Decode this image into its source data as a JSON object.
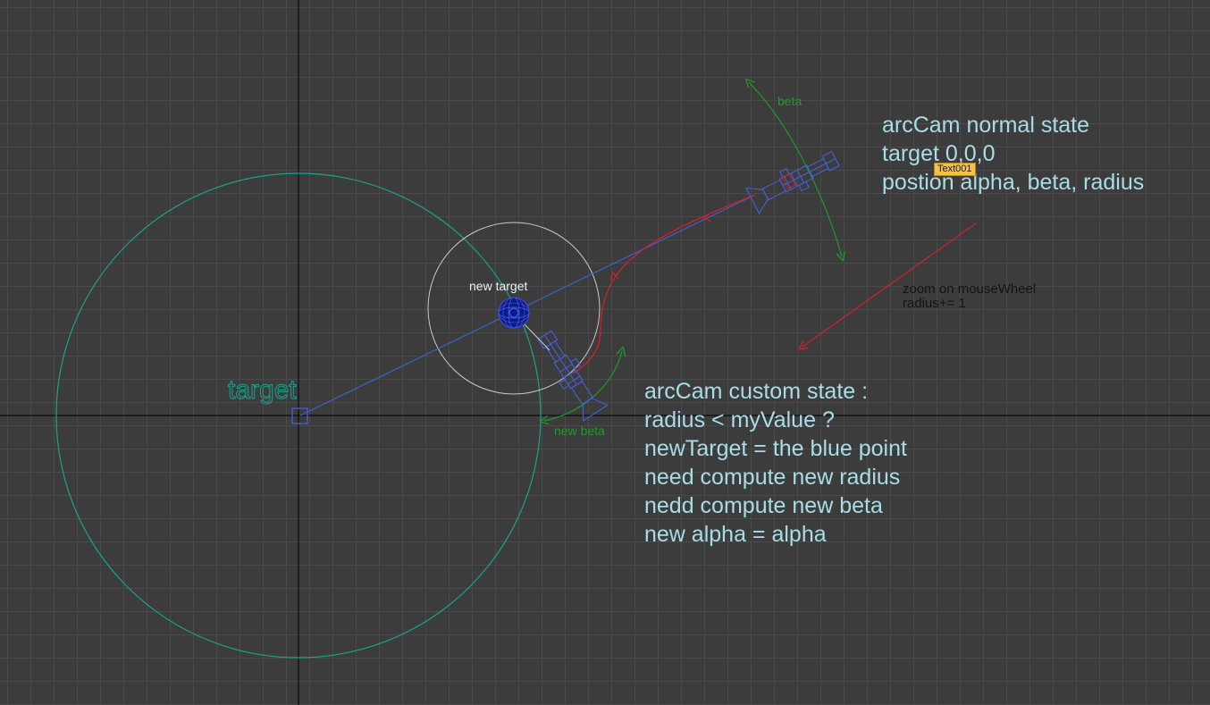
{
  "labels": {
    "target": "target",
    "new_target": "new target",
    "beta": "beta",
    "new_beta": "new beta",
    "object_tag": "Text001"
  },
  "normal_state": [
    "arcCam normal state",
    "target 0,0,0",
    "postion alpha, beta, radius"
  ],
  "zoom_note": [
    "zoom on mouseWheel",
    "radius+= 1"
  ],
  "custom_state": [
    "arcCam custom state :",
    "radius < myValue ?",
    "newTarget = the blue point",
    "need compute new radius",
    "nedd compute new beta",
    "new alpha = alpha"
  ],
  "colors": {
    "background": "#3c3c3c",
    "grid": "#4a4a4a",
    "axis": "#0a0a0a",
    "orbit": "#1aa38a",
    "small_orbit": "#c8c8c8",
    "camera": "#4460d8",
    "view_line": "#3a62c8",
    "path_red": "#d2202e",
    "arc_green": "#1f9a2a",
    "text_cyan": "#a8dde7",
    "text_dark": "#141414",
    "badge": "#f2c14a"
  }
}
